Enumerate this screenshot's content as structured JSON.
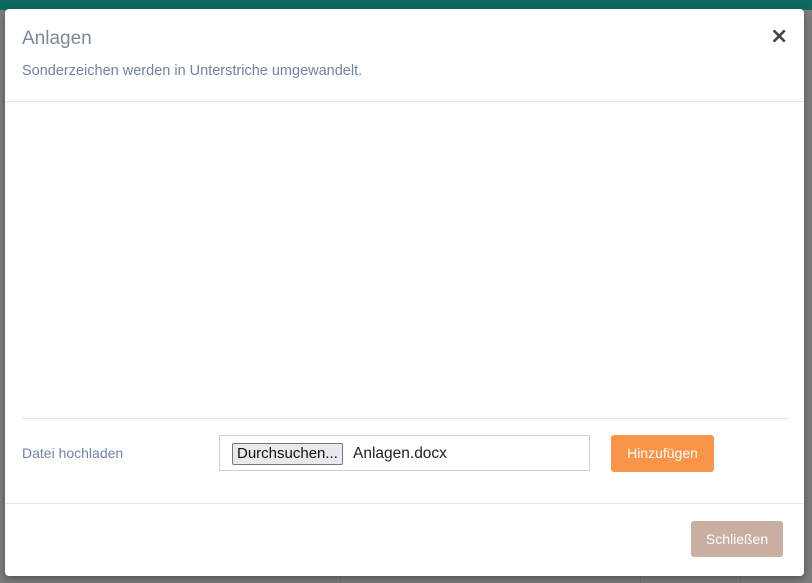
{
  "modal": {
    "title": "Anlagen",
    "subtitle": "Sonderzeichen werden in Unterstriche umgewandelt.",
    "close_symbol": "×",
    "upload": {
      "label": "Datei hochladen",
      "browse_label": "Durchsuchen...",
      "file_name": "Anlagen.docx",
      "add_label": "Hinzufügen"
    },
    "footer": {
      "close_label": "Schließen"
    }
  },
  "colors": {
    "accent_orange": "#f89548",
    "close_button": "#c9aea2",
    "title_text": "#7a8a9c",
    "topbar": "#0e6a60"
  },
  "icons": {
    "close": "close-icon"
  }
}
